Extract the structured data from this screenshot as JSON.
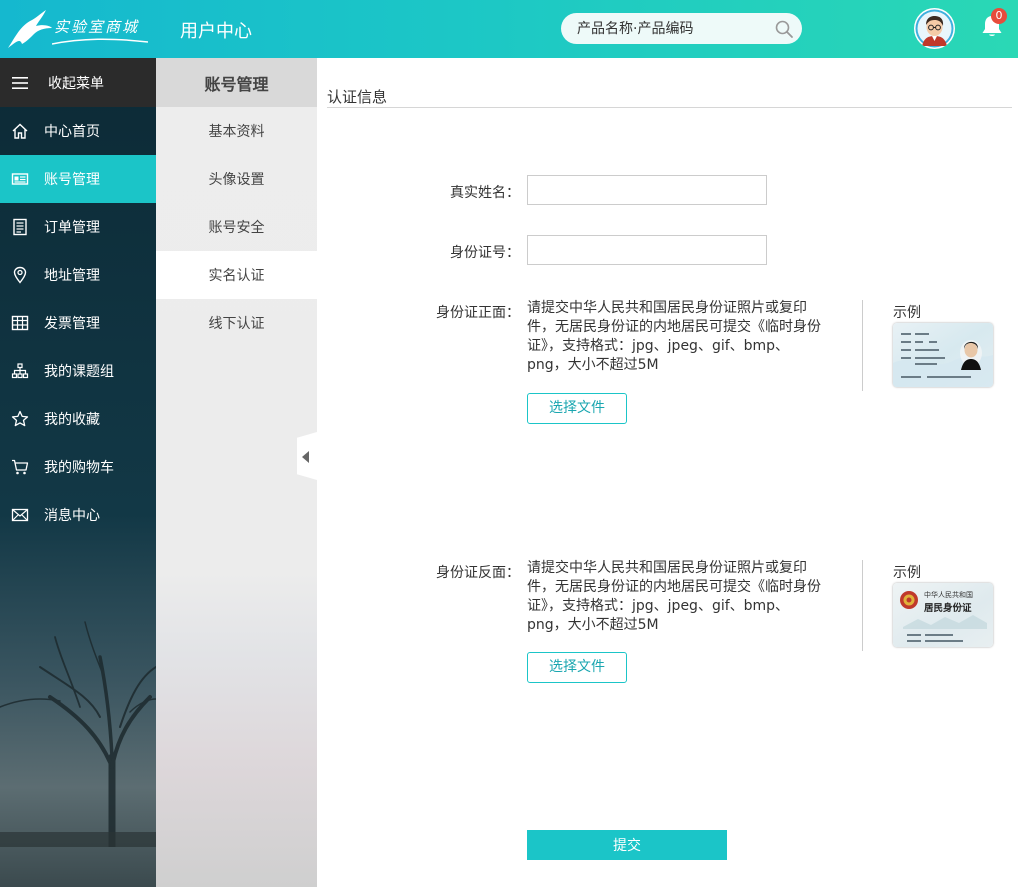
{
  "header": {
    "logo_text": "实验室商城",
    "title": "用户中心",
    "search_placeholder": "产品名称·产品编码",
    "notification_count": "0"
  },
  "sidebar": {
    "collapse_label": "收起菜单",
    "items": [
      {
        "label": "中心首页",
        "icon": "home-icon"
      },
      {
        "label": "账号管理",
        "icon": "id-card-icon",
        "active": true
      },
      {
        "label": "订单管理",
        "icon": "document-icon"
      },
      {
        "label": "地址管理",
        "icon": "location-pin-icon"
      },
      {
        "label": "发票管理",
        "icon": "table-grid-icon"
      },
      {
        "label": "我的课题组",
        "icon": "org-chart-icon"
      },
      {
        "label": "我的收藏",
        "icon": "star-icon"
      },
      {
        "label": "我的购物车",
        "icon": "shopping-cart-icon"
      },
      {
        "label": "消息中心",
        "icon": "envelope-icon"
      }
    ]
  },
  "submenu": {
    "title": "账号管理",
    "items": [
      "基本资料",
      "头像设置",
      "账号安全",
      "实名认证",
      "线下认证"
    ],
    "active_index": 3
  },
  "content": {
    "section_title": "认证信息",
    "real_name_label": "真实姓名：",
    "real_name_value": "",
    "id_number_label": "身份证号：",
    "id_number_value": "",
    "front_label": "身份证正面：",
    "front_desc": "请提交中华人民共和国居民身份证照片或复印件，无居民身份证的内地居民可提交《临时身份证》，支持格式：jpg、jpeg、gif、bmp、png，大小不超过5M",
    "front_button": "选择文件",
    "front_example_label": "示例",
    "back_label": "身份证反面：",
    "back_desc": "请提交中华人民共和国居民身份证照片或复印件，无居民身份证的内地居民可提交《临时身份证》，支持格式：jpg、jpeg、gif、bmp、png，大小不超过5M",
    "back_button": "选择文件",
    "back_example_label": "示例",
    "back_card_text_1": "中华人民共和国",
    "back_card_text_2": "居民身份证",
    "submit_label": "提交"
  },
  "colors": {
    "accent": "#1bc5c8",
    "sidebar_dark": "#0c2a36",
    "badge": "#e74c3c"
  }
}
